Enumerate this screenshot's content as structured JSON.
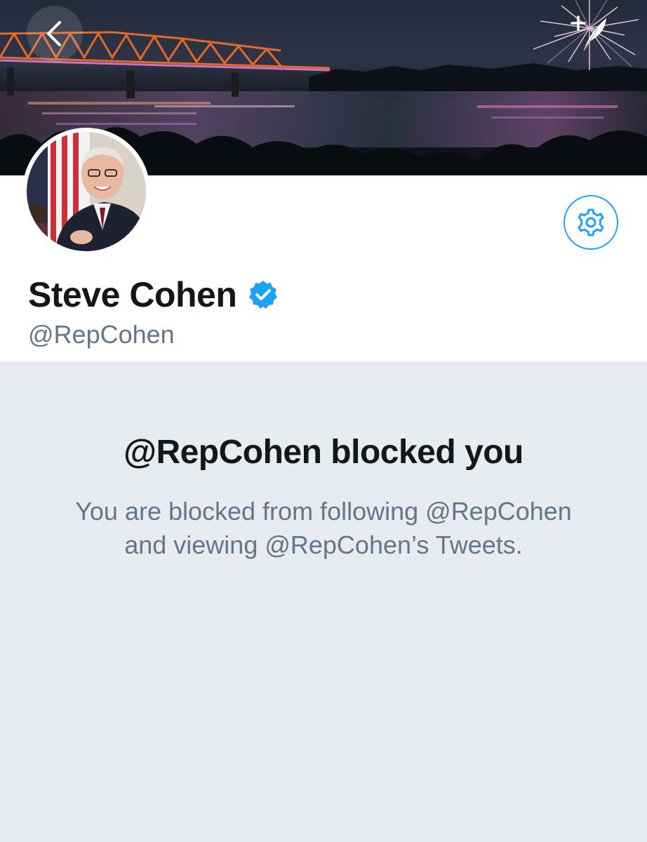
{
  "banner": {
    "back_icon": "chevron-left-icon",
    "compose_icon": "compose-tweet-icon"
  },
  "profile": {
    "display_name": "Steve Cohen",
    "handle": "@RepCohen",
    "verified": true,
    "verified_icon": "verified-badge-icon",
    "settings_icon": "gear-icon"
  },
  "blocked": {
    "title": "@RepCohen blocked you",
    "message": "You are blocked from following @RepCohen and viewing @RepCohen’s Tweets."
  },
  "colors": {
    "accent": "#1da1f2",
    "text_primary": "#14171a",
    "text_secondary": "#657786",
    "panel_background": "#e6ecf0"
  }
}
